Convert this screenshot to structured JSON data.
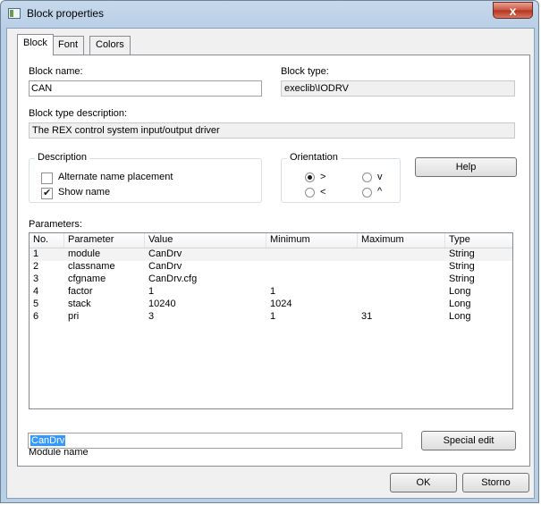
{
  "window": {
    "title": "Block properties",
    "close_glyph": "x"
  },
  "tabs": [
    {
      "label": "Block",
      "active": true
    },
    {
      "label": "Font",
      "active": false
    },
    {
      "label": "Colors",
      "active": false
    }
  ],
  "block_name": {
    "label": "Block name:",
    "value": "CAN"
  },
  "block_type": {
    "label": "Block type:",
    "value": "execlib\\IODRV"
  },
  "block_type_description": {
    "label": "Block type description:",
    "value": "The REX control system input/output driver"
  },
  "description_group": {
    "title": "Description",
    "alternate_name_placement": {
      "label": "Alternate name placement",
      "checked": false
    },
    "show_name": {
      "label": "Show name",
      "checked": true
    }
  },
  "orientation_group": {
    "title": "Orientation",
    "options": [
      {
        "label": ">",
        "selected": true
      },
      {
        "label": "v",
        "selected": false
      },
      {
        "label": "<",
        "selected": false
      },
      {
        "label": "^",
        "selected": false
      }
    ]
  },
  "help_button": "Help",
  "parameters": {
    "label": "Parameters:",
    "columns": [
      "No.",
      "Parameter",
      "Value",
      "Minimum",
      "Maximum",
      "Type"
    ],
    "rows": [
      [
        "1",
        "module",
        "CanDrv",
        "",
        "",
        "String"
      ],
      [
        "2",
        "classname",
        "CanDrv",
        "",
        "",
        "String"
      ],
      [
        "3",
        "cfgname",
        "CanDrv.cfg",
        "",
        "",
        "String"
      ],
      [
        "4",
        "factor",
        "1",
        "1",
        "",
        "Long"
      ],
      [
        "5",
        "stack",
        "10240",
        "1024",
        "",
        "Long"
      ],
      [
        "6",
        "pri",
        "3",
        "1",
        "31",
        "Long"
      ]
    ]
  },
  "module_name": {
    "label": "Module name",
    "value": "CanDrv"
  },
  "special_edit_button": "Special edit",
  "ok_button": "OK",
  "cancel_button": "Storno",
  "colors": {
    "selection": "#3399ff",
    "titlebar": "#b9cfe6",
    "close_button": "#c9543f"
  }
}
